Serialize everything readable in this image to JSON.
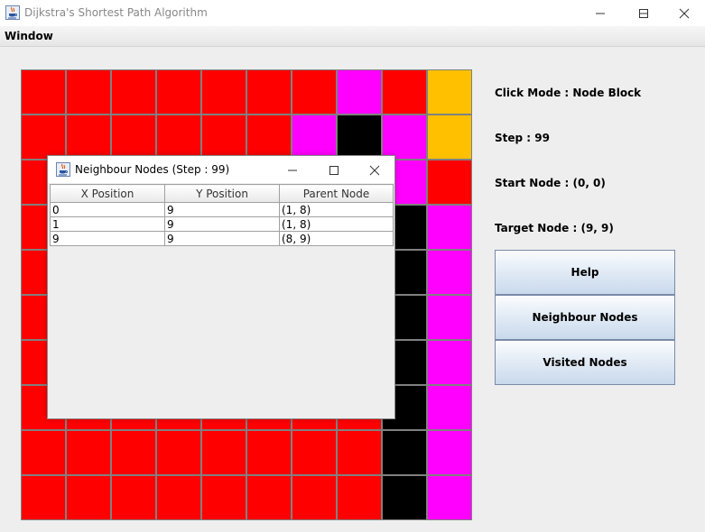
{
  "window": {
    "title": "Dijkstra's Shortest Path Algorithm",
    "minimize_icon": "minimize-icon",
    "maximize_icon": "maximize-icon",
    "close_icon": "close-icon"
  },
  "menu": {
    "items": [
      "Window"
    ]
  },
  "colors": {
    "R": "#ff0000",
    "M": "#ff00ff",
    "K": "#000000",
    "Y": "#ffc000"
  },
  "grid": {
    "rows": [
      "RRRRRRRMRY",
      "RRRRRRMKMY",
      "RRRRRRKKMR",
      "RRRRRRRRKM",
      "RRRRRRRRKM",
      "RRRRRRRRKM",
      "RRRRRRRRKM",
      "RRRRRRRRKM",
      "RRRRRRRRKM",
      "RRRRRRRRKM"
    ]
  },
  "info": {
    "click_mode": "Click Mode : Node Block",
    "step": "Step : 99",
    "start_node": "Start Node : (0, 0)",
    "target_node": "Target Node : (9, 9)"
  },
  "buttons": {
    "help": "Help",
    "neighbour_nodes": "Neighbour Nodes",
    "visited_nodes": "Visited Nodes"
  },
  "dialog": {
    "title": "Neighbour Nodes (Step : 99)",
    "columns": [
      "X Position",
      "Y Position",
      "Parent Node"
    ],
    "rows": [
      [
        "0",
        "9",
        "(1, 8)"
      ],
      [
        "1",
        "9",
        "(1, 8)"
      ],
      [
        "9",
        "9",
        "(8, 9)"
      ]
    ]
  }
}
